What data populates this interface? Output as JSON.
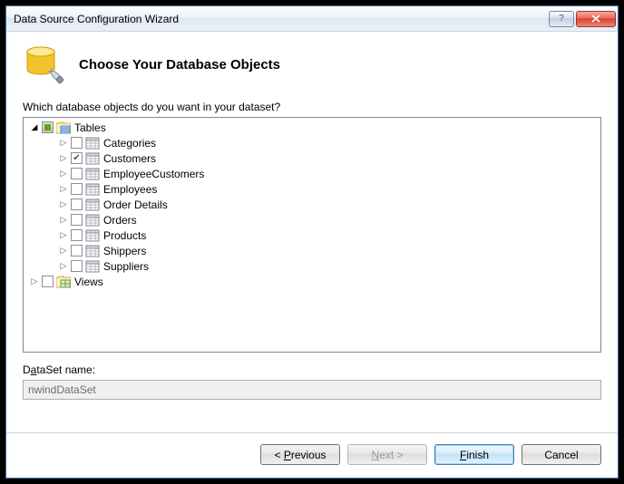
{
  "title": "Data Source Configuration Wizard",
  "header": {
    "heading": "Choose Your Database Objects"
  },
  "prompt": "Which database objects do you want in your dataset?",
  "tree": {
    "tables_label": "Tables",
    "views_label": "Views",
    "items": [
      {
        "label": "Categories",
        "checked": false
      },
      {
        "label": "Customers",
        "checked": true
      },
      {
        "label": "EmployeeCustomers",
        "checked": false
      },
      {
        "label": "Employees",
        "checked": false
      },
      {
        "label": "Order Details",
        "checked": false
      },
      {
        "label": "Orders",
        "checked": false
      },
      {
        "label": "Products",
        "checked": false
      },
      {
        "label": "Shippers",
        "checked": false
      },
      {
        "label": "Suppliers",
        "checked": false
      }
    ]
  },
  "dataset": {
    "label_prefix": "D",
    "label_underline": "a",
    "label_suffix": "taSet name:",
    "value": "nwindDataSet"
  },
  "buttons": {
    "prev_prefix": "< ",
    "prev_underline": "P",
    "prev_suffix": "revious",
    "next_prefix": "",
    "next_underline": "N",
    "next_suffix": "ext >",
    "finish_prefix": "",
    "finish_underline": "F",
    "finish_suffix": "inish",
    "cancel": "Cancel"
  }
}
